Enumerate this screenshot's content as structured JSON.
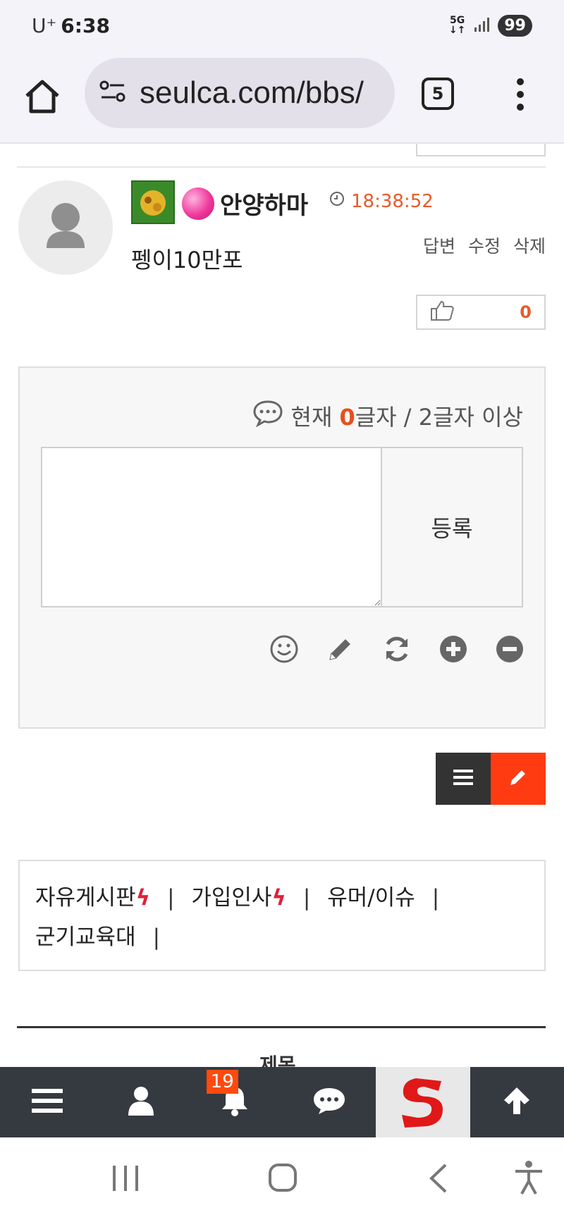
{
  "status_bar": {
    "carrier": "U⁺",
    "time": "6:38",
    "network": "5G",
    "battery": "99"
  },
  "browser": {
    "url": "seulca.com/bbs/",
    "tab_count": "5"
  },
  "comment": {
    "nickname": "안양하마",
    "time": "18:38:52",
    "actions": [
      "답변",
      "수정",
      "삭제"
    ],
    "text": "펭이10만포",
    "likes": "0"
  },
  "comment_form": {
    "counter_prefix": "현재",
    "counter_value": "0",
    "counter_suffix": "글자 / 2글자 이상",
    "submit_label": "등록"
  },
  "categories": [
    {
      "label": "자유게시판",
      "hot": true
    },
    {
      "label": "가입인사",
      "hot": true
    },
    {
      "label": "유머/이슈",
      "hot": false
    },
    {
      "label": "군기교육대",
      "hot": false
    }
  ],
  "hot_symbol": "ϟ",
  "table": {
    "header": "제목"
  },
  "bottom_nav": {
    "notification_count": "19"
  },
  "colors": {
    "accent": "#ff3b12",
    "time": "#e85a2a",
    "nav_bg": "#353a40"
  }
}
